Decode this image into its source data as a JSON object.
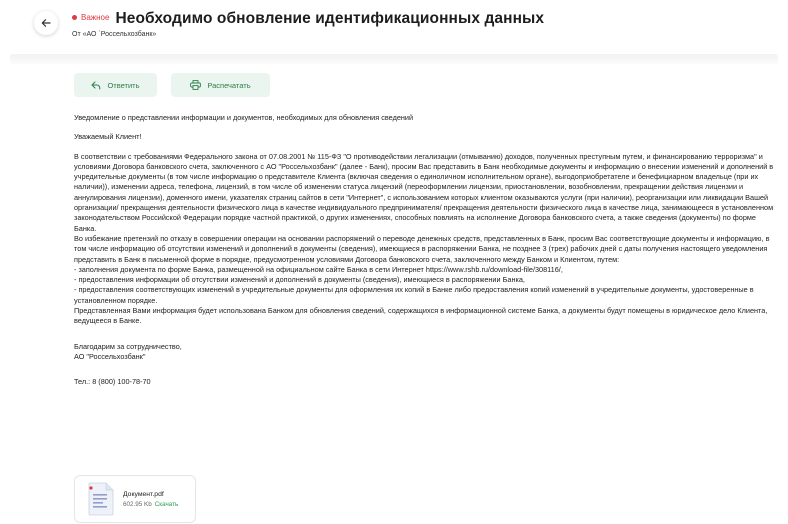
{
  "header": {
    "badge": "Важное",
    "title": "Необходимо обновление идентификационных данных",
    "sender": "От «АО `Россельхозбанк»"
  },
  "actions": {
    "reply_label": "Ответить",
    "print_label": "Распечатать"
  },
  "message": {
    "subject": "Уведомление о представлении информации и документов, необходимых для обновления сведений",
    "greeting": "Уважаемый Клиент!",
    "paragraphs": [
      "В соответствии с требованиями Федерального закона от 07.08.2001 № 115-ФЗ \"О противодействии легализации (отмыванию) доходов, полученных преступным путем, и финансированию терроризма\" и условиями Договора банковского счета, заключенного с АО \"Россельхозбанк\" (далее - Банк), просим Вас представить в Банк необходимые документы и информацию о внесении изменений и дополнений в учредительные документы (в том числе информацию о представителе Клиента (включая сведения о единоличном исполнительном органе), выгодоприобретателе и бенефициарном владельце (при их наличии)), изменении адреса, телефона, лицензий, в том числе об изменении статуса лицензий (переоформлении лицензии, приостановлении, возобновлении, прекращении действия лицензии и аннулирования лицензии), доменного имени, указателях страниц сайтов в сети \"Интернет\", с использованием которых клиентом оказываются услуги (при наличии), реорганизации или ликвидации Вашей организации/ прекращения деятельности физического лица в качестве индивидуального предпринимателя/ прекращения деятельности физического лица в качестве лица, занимающееся в установленном законодательством Российской Федерации порядке частной практикой, о других изменениях, способных повлиять на исполнение Договора банковского счета, а также сведения (документы) по форме Банка.",
      "Во избежание претензий по отказу в совершении операции на основании распоряжений о переводе денежных средств, представленных в Банк, просим Вас соответствующие документы и информацию, в том числе информацию об отсутствии изменений и дополнений в документы (сведения), имеющиеся в распоряжении Банка, не позднее 3 (трех) рабочих дней с даты получения настоящего уведомления представить в Банк в письменной форме в порядке, предусмотренном условиями Договора банковского счета, заключенного между Банком и Клиентом, путем:",
      "- заполнения документа по форме Банка, размещенной на официальном сайте Банка в сети Интернет https://www.rshb.ru/download-file/308116/,",
      "- предоставления информации об отсутствии изменений и дополнений в документы (сведения), имеющиеся в распоряжении Банка,",
      "- предоставления соответствующих изменений в учредительные документы для оформления их копий в Банке либо предоставления копий изменений в учредительные документы, удостоверенные в установленном порядке.",
      "Представленная Вами информация будет использована Банком для обновления сведений, содержащихся в информационной системе Банка, а документы будут помещены в юридическое дело Клиента, ведущееся в Банке."
    ],
    "closing_1": "Благодарим за сотрудничество,",
    "closing_2": "АО \"Россельхозбанк\"",
    "phone": "Тел.: 8 (800) 100-78-70"
  },
  "attachment": {
    "name": "Документ.pdf",
    "size": "602.95 Kb",
    "download_label": "Скачать",
    "icon": "pdf-document-icon"
  },
  "colors": {
    "accent_green": "#2f7d4b",
    "button_bg": "#e9f5ee",
    "important_red": "#e0393e"
  }
}
